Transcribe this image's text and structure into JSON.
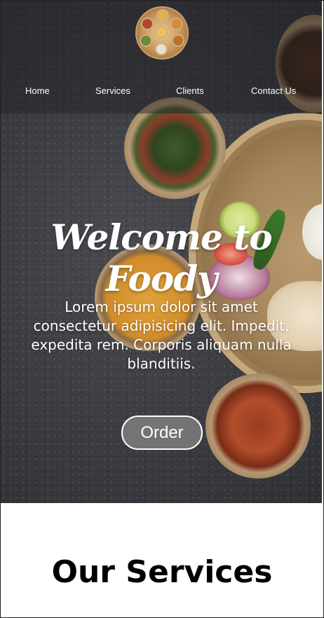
{
  "brand": {
    "logo_icon": "thali-plate-logo-icon"
  },
  "nav": {
    "items": [
      {
        "label": "Home"
      },
      {
        "label": "Services"
      },
      {
        "label": "Clients"
      },
      {
        "label": "Contact Us"
      }
    ]
  },
  "hero": {
    "title": "Welcome to Foody",
    "text": "Lorem ipsum dolor sit amet consectetur adipisicing elit. Impedit, expedita rem. Corporis aliquam nulla blanditiis.",
    "order_label": "Order"
  },
  "services": {
    "title": "Our Services"
  },
  "colors": {
    "hero_background": "#3b3c41",
    "text_on_hero": "#ffffff",
    "button_fill": "#78787a"
  }
}
